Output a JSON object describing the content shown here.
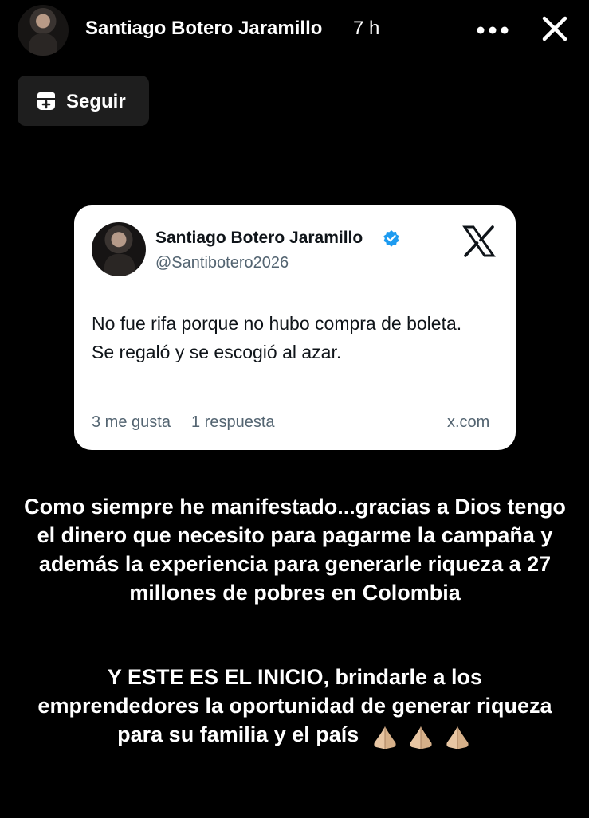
{
  "header": {
    "name": "Santiago Botero Jaramillo",
    "time": "7 h",
    "more_icon": "more-horizontal-icon",
    "close_icon": "close-icon"
  },
  "follow_button": {
    "label": "Seguir",
    "icon": "follow-icon"
  },
  "tweet": {
    "name": "Santiago Botero Jaramillo",
    "handle": "@Santibotero2026",
    "verified": true,
    "text": "No fue rifa porque no hubo compra de boleta. Se regaló y se escogió al azar.",
    "likes": "3 me gusta",
    "replies": "1 respuesta",
    "source": "x.com",
    "logo": "x-logo-icon"
  },
  "caption": {
    "paragraph1": "Como siempre he manifestado...gracias a Dios tengo el dinero que necesito para pagarme la campaña y además la experiencia para generarle riqueza a 27 millones de pobres en Colombia",
    "paragraph2": "Y ESTE ES EL INICIO,  brindarle a los emprendedores la oportunidad de generar riqueza para su familia y el país",
    "emoji_icon": "praying-hands-icon",
    "emoji_count": 3
  },
  "colors": {
    "background": "#000000",
    "card_background": "#ffffff",
    "verified_blue": "#1d9bf0",
    "muted_text": "#536471",
    "follow_button_bg": "#1e1e1e"
  }
}
